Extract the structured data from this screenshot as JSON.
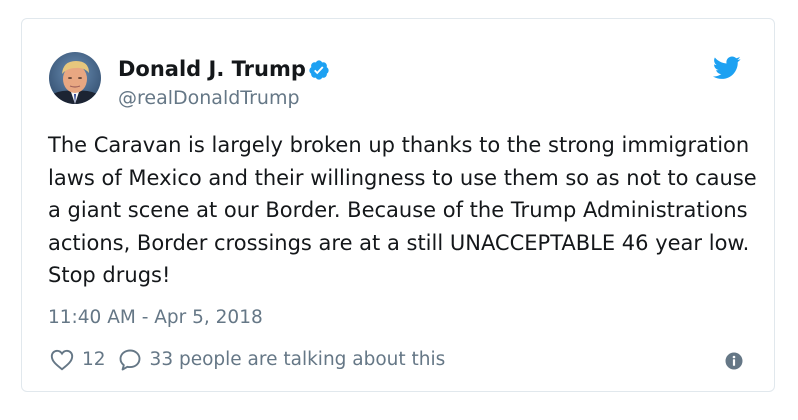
{
  "author": {
    "display_name": "Donald J. Trump",
    "handle": "@realDonaldTrump",
    "verified": true
  },
  "tweet": {
    "text": "The Caravan is largely broken up thanks to the strong immigration laws of Mexico and their willingness to use them so as not to cause a giant scene at our Border. Because of the Trump Administrations actions, Border crossings are at a still UNACCEPTABLE 46 year low. Stop drugs!",
    "timestamp": "11:40 AM - Apr 5, 2018"
  },
  "actions": {
    "like_count": "12",
    "talking_text": "33 people are talking about this"
  },
  "icons": {
    "like": "heart-icon",
    "reply": "speech-bubble-icon",
    "info": "info-icon",
    "brand": "twitter-bird-icon",
    "verified": "verified-badge-icon"
  },
  "colors": {
    "brand_blue": "#1da1f2",
    "text_primary": "#14171a",
    "text_secondary": "#657786",
    "border": "#e1e8ed"
  }
}
